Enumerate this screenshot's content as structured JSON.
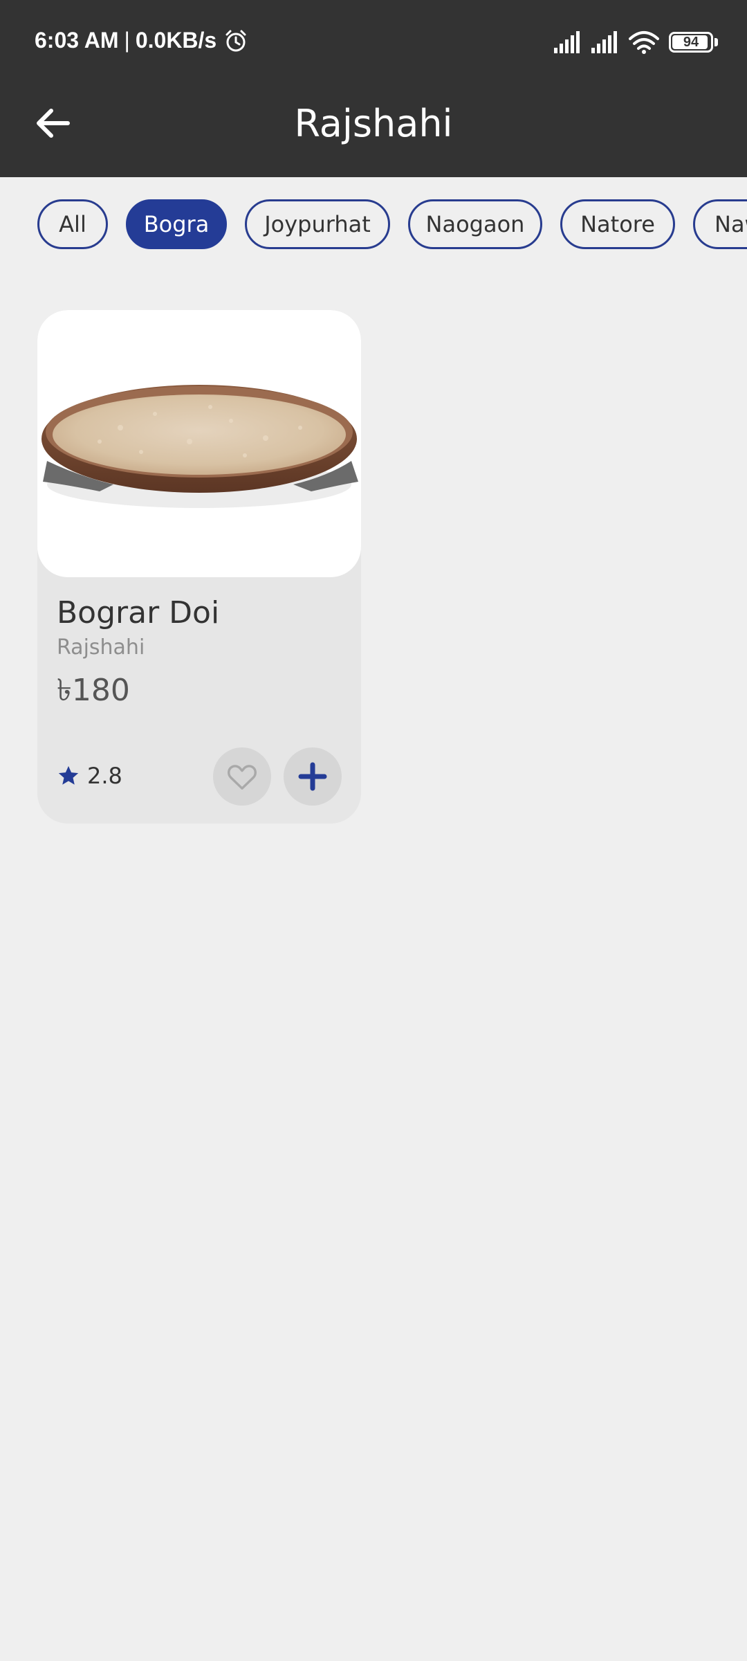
{
  "status_bar": {
    "time": "6:03 AM",
    "separator": "|",
    "network_speed": "0.0KB/s",
    "battery_level": "94",
    "icons": [
      "alarm-icon",
      "signal-icon",
      "signal-icon",
      "wifi-icon",
      "battery-icon"
    ]
  },
  "header": {
    "back_icon": "arrow-left-icon",
    "title": "Rajshahi"
  },
  "filters": {
    "selected": "Bogra",
    "chips": [
      {
        "label": "All",
        "active": false
      },
      {
        "label": "Bogra",
        "active": true
      },
      {
        "label": "Joypurhat",
        "active": false
      },
      {
        "label": "Naogaon",
        "active": false
      },
      {
        "label": "Natore",
        "active": false
      },
      {
        "label": "Naw",
        "active": false
      }
    ]
  },
  "products": [
    {
      "name": "Bograr Doi",
      "region": "Rajshahi",
      "price": "৳180",
      "rating": "2.8",
      "rating_icon": "star-icon",
      "favorite_icon": "heart-outline-icon",
      "add_icon": "plus-icon"
    }
  ],
  "colors": {
    "header_bg": "#333333",
    "accent": "#243c96",
    "page_bg": "#efefef",
    "card_bg": "#e6e6e6"
  }
}
